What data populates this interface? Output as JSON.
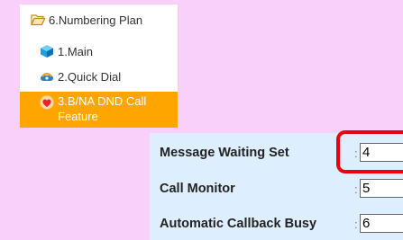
{
  "tree": {
    "root": {
      "label": "6.Numbering Plan",
      "icon": "folder-open-icon"
    },
    "items": [
      {
        "label": "1.Main",
        "icon": "cube-icon"
      },
      {
        "label": "2.Quick Dial",
        "icon": "quick-dial-icon"
      },
      {
        "label": "3.B/NA DND Call Feature",
        "icon": "heart-icon",
        "selected": true
      }
    ]
  },
  "fields": [
    {
      "label": "Message Waiting Set",
      "value": "4",
      "highlighted": true
    },
    {
      "label": "Call Monitor",
      "value": "5"
    },
    {
      "label": "Automatic Callback Busy",
      "value": "6"
    }
  ],
  "separator": ":",
  "colors": {
    "background": "#f9d0f9",
    "selection": "#ffa500",
    "panel": "#ddeeff",
    "highlight": "#e8000e"
  }
}
